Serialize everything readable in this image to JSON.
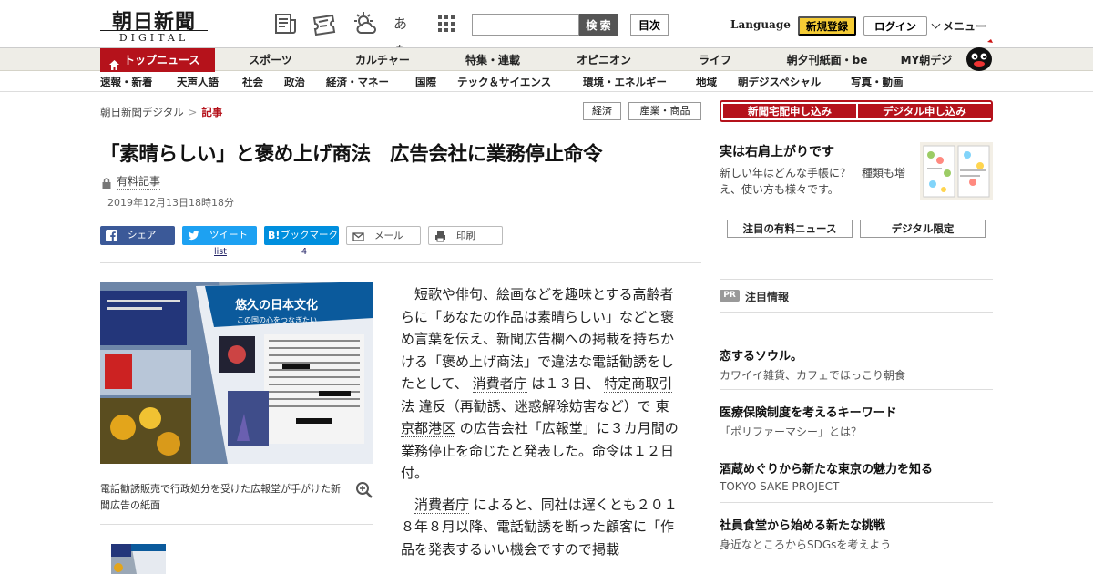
{
  "header": {
    "logo_main": "朝日新聞",
    "logo_sub": "DIGITAL",
    "icons": [
      "newspaper-icon",
      "ticket-icon",
      "weather-icon",
      "font-size-icon",
      "grid-menu-icon"
    ],
    "font_size_label": "あぁ",
    "search_placeholder": "",
    "search_button": "検 索",
    "toc_button": "目次",
    "language": "Language",
    "register_button": "新規登録",
    "login_button": "ログイン",
    "menu_button": "メニュー"
  },
  "nav_primary": {
    "active": "トップニュース",
    "items": [
      "スポーツ",
      "カルチャー",
      "特集・連載",
      "オピニオン",
      "ライフ",
      "朝夕刊紙面・be",
      "MY朝デジ"
    ]
  },
  "nav_secondary": {
    "items": [
      "速報・新着",
      "天声人語",
      "社会",
      "政治",
      "経済・マネー",
      "国際",
      "テック＆サイエンス",
      "環境・エネルギー",
      "地域",
      "朝デジスペシャル",
      "写真・動画"
    ]
  },
  "breadcrumb": {
    "home": "朝日新聞デジタル",
    "separator": ">",
    "current": "記事"
  },
  "tags": [
    "経済",
    "産業・商品"
  ],
  "article": {
    "headline": "「素晴らしい」と褒め上げ商法　広告会社に業務停止命令",
    "paid_label": "有料記事",
    "date": "2019年12月13日18時18分",
    "share": {
      "facebook": "シェア",
      "twitter": "ツイート",
      "twitter_count": "list",
      "hatena_mark": "B!",
      "hatena": "ブックマーク",
      "hatena_count": "4",
      "mail": "メール",
      "print": "印刷"
    },
    "photo_caption": "電話勧誘販売で行政処分を受けた広報堂が手がけた新聞広告の紙面",
    "photo_headline": "悠久の日本文化",
    "photo_subheadline": "この国の心をつなぎたい",
    "p1": {
      "t1": "短歌や俳句、絵画などを趣味とする高齢者らに「あなたの作品は素晴らしい」などと褒め言葉を伝え、新聞広告欄への掲載を持ちかける「褒め上げ商法」で違法な電話勧誘をしたとして、",
      "k1": "消費者庁",
      "t2": "は１３日、",
      "k2": "特定商取引法",
      "t3": "違反（再勧誘、迷惑解除妨害など）で",
      "k3": "東京都港区",
      "t4": "の広告会社「広報堂」に３カ月間の業務停止を命じたと発表した。命令は１２日付。"
    },
    "p2": {
      "k1": "消費者庁",
      "t1": "によると、同社は遅くとも２０１８年８月以降、電話勧誘を断った顧客に「作品を発表するいい機会ですので掲載"
    }
  },
  "sidebar": {
    "subscribe_newspaper": "新聞宅配申し込み",
    "subscribe_digital": "デジタル申し込み",
    "promo_title": "実は右肩上がりです",
    "promo_text": "新しい年はどんな手帳に？　種類も増え、使い方も様々です。",
    "tab_paid_news": "注目の有料ニュース",
    "tab_digital": "デジタル限定",
    "pr_badge": "PR",
    "pr_title": "注目情報",
    "pr_items": [
      {
        "title": "恋するソウル。",
        "sub": "カワイイ雑貨、カフェでほっこり朝食"
      },
      {
        "title": "医療保険制度を考えるキーワード",
        "sub": "「ポリファーマシー」とは？"
      },
      {
        "title": "酒蔵めぐりから新たな東京の魅力を知る",
        "sub": "TOKYO SAKE PROJECT"
      },
      {
        "title": "社員食堂から始める新たな挑戦",
        "sub": "身近なところからSDGsを考えよう"
      }
    ]
  },
  "colors": {
    "brand_red": "#b5121b",
    "nav_bg": "#eeede7",
    "register_yellow": "#f5cc35",
    "facebook": "#3b5998",
    "twitter": "#1da1f2",
    "hatena": "#008fde"
  }
}
